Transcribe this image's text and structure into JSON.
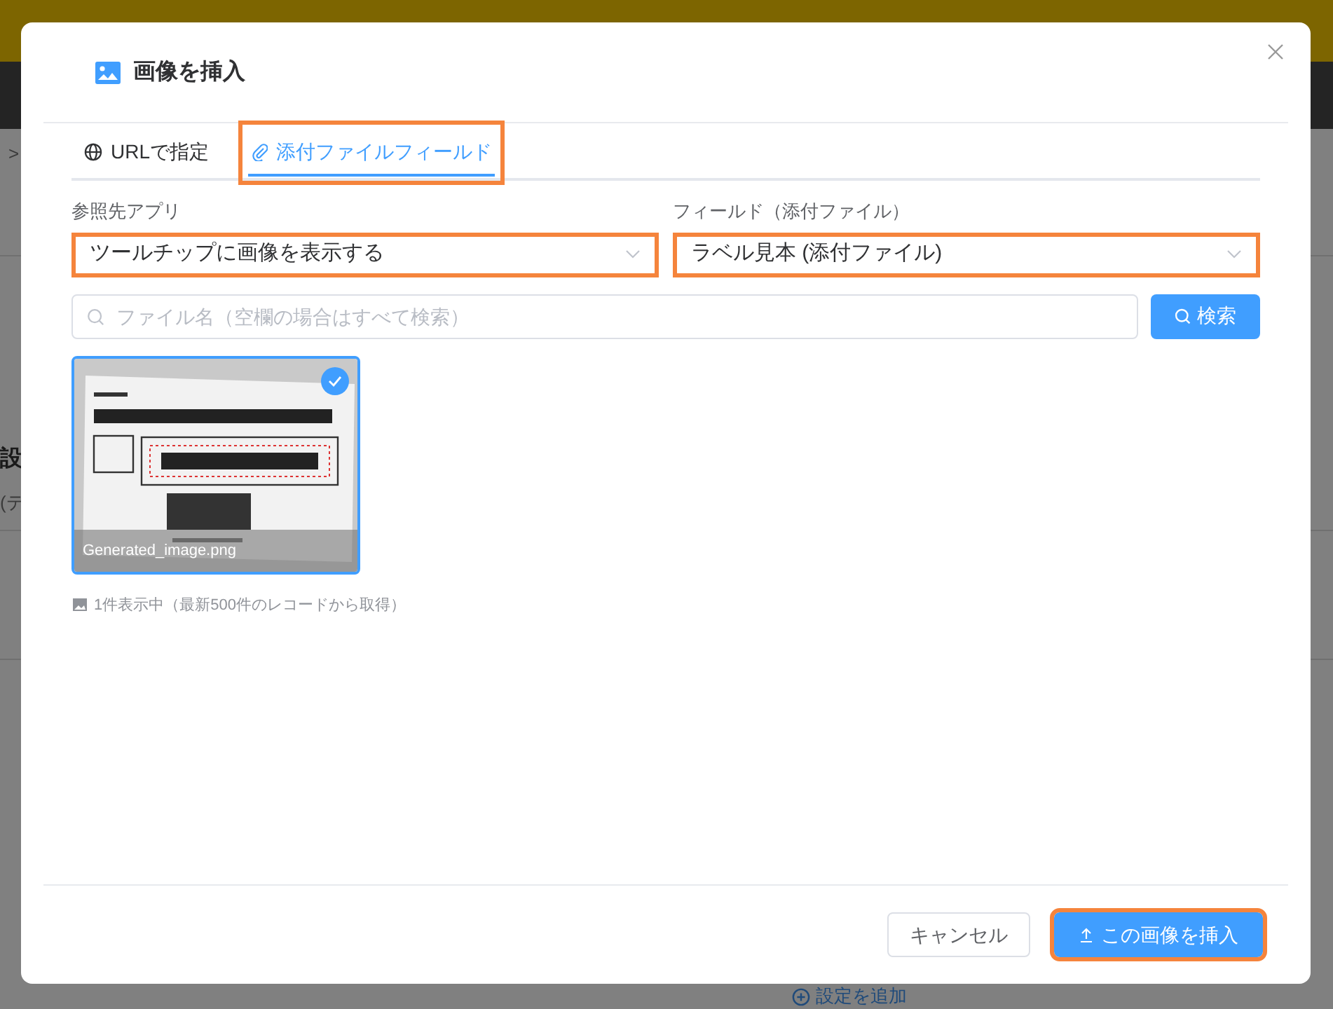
{
  "background": {
    "breadcrumb_mark": ">",
    "section_title": "設",
    "section_note": "(テ",
    "add_setting": "設定を追加"
  },
  "dialog": {
    "title": "画像を挿入",
    "tabs": [
      {
        "label": "URLで指定",
        "kind": "globe",
        "selected": false,
        "highlighted": false
      },
      {
        "label": "添付ファイルフィールド",
        "kind": "clip",
        "selected": true,
        "highlighted": true
      }
    ],
    "fields": [
      {
        "label": "参照先アプリ",
        "value": "ツールチップに画像を表示する",
        "highlighted": true
      },
      {
        "label": "フィールド（添付ファイル）",
        "value": "ラベル見本 (添付ファイル)",
        "highlighted": true
      }
    ],
    "search": {
      "placeholder": "ファイル名（空欄の場合はすべて検索）",
      "button": "検索"
    },
    "images": [
      {
        "kind": "picture",
        "filename": "Generated_image.png",
        "selected": true
      }
    ],
    "caption": "1件表示中（最新500件のレコードから取得）",
    "buttons": [
      {
        "label": "キャンセル",
        "kind": "secondary",
        "highlighted": false
      },
      {
        "label": "この画像を挿入",
        "kind": "primary",
        "highlighted": true
      }
    ]
  }
}
